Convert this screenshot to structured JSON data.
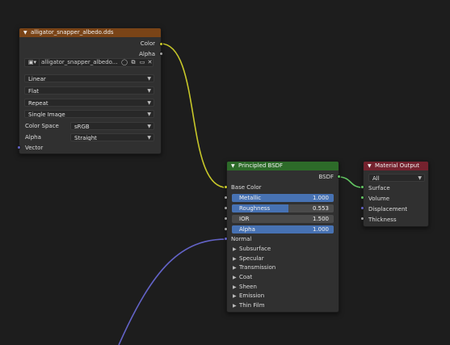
{
  "colors": {
    "texture_header": "#7a4417",
    "bsdf_header": "#2d6b29",
    "output_header": "#74222e",
    "socket_color": "#c7c729",
    "socket_float": "#a1a1a1",
    "socket_shader": "#63c763",
    "socket_vector": "#6363c7",
    "accent": "#4772b3"
  },
  "image_texture": {
    "title": "alligator_snapper_albedo.dds",
    "outputs": {
      "color": "Color",
      "alpha": "Alpha"
    },
    "image_name": "alligator_snapper_albedo....",
    "interpolation": "Linear",
    "projection": "Flat",
    "extension": "Repeat",
    "source": "Single Image",
    "color_space_label": "Color Space",
    "color_space_value": "sRGB",
    "alpha_label": "Alpha",
    "alpha_value": "Straight",
    "vector_label": "Vector",
    "icons": [
      "image-browse-icon",
      "fake-user-shield-icon",
      "new-image-icon",
      "open-folder-icon",
      "close-icon"
    ]
  },
  "principled": {
    "title": "Principled BSDF",
    "output_label": "BSDF",
    "base_color_label": "Base Color",
    "sliders": [
      {
        "label": "Metallic",
        "value": "1.000",
        "fraction": 1.0
      },
      {
        "label": "Roughness",
        "value": "0.553",
        "fraction": 0.553
      },
      {
        "label": "IOR",
        "value": "1.500",
        "fraction": 0.0
      },
      {
        "label": "Alpha",
        "value": "1.000",
        "fraction": 1.0
      }
    ],
    "normal_label": "Normal",
    "panels": [
      "Subsurface",
      "Specular",
      "Transmission",
      "Coat",
      "Sheen",
      "Emission",
      "Thin Film"
    ]
  },
  "material_output": {
    "title": "Material Output",
    "target": "All",
    "inputs": [
      "Surface",
      "Volume",
      "Displacement",
      "Thickness"
    ]
  }
}
